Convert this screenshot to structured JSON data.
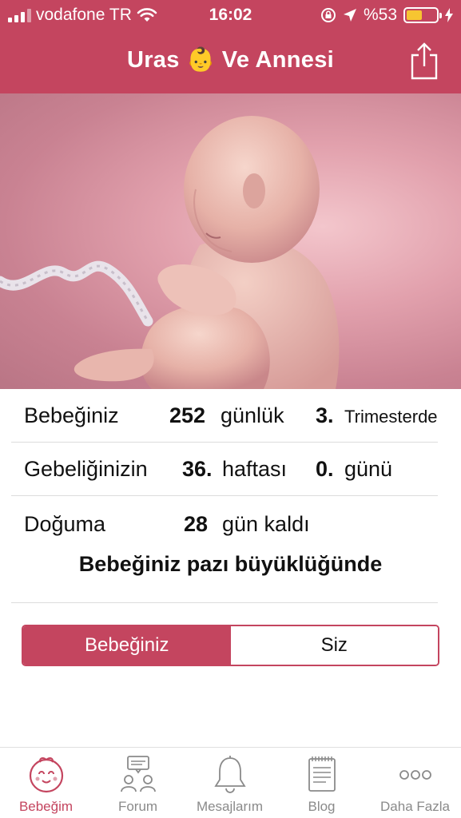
{
  "status_bar": {
    "carrier": "vodafone TR",
    "time": "16:02",
    "battery_text": "%53",
    "battery_level": 0.53
  },
  "nav": {
    "title": "Uras 👶 Ve Annesi",
    "share_icon": "share-icon"
  },
  "info": {
    "row1": {
      "label": "Bebeğiniz",
      "days_num": "252",
      "days_unit": "günlük",
      "trimester_num": "3.",
      "trimester_label": "Trimesterde"
    },
    "row2": {
      "label": "Gebeliğinizin",
      "week_num": "36.",
      "week_unit": "haftası",
      "day_num": "0.",
      "day_unit": "günü"
    },
    "row3": {
      "label": "Doğuma",
      "days_left_num": "28",
      "days_left_unit": "gün kaldı"
    },
    "size_text": "Bebeğiniz pazı büyüklüğünde"
  },
  "segment": {
    "options": [
      "Bebeğiniz",
      "Siz"
    ],
    "selected": "Bebeğiniz"
  },
  "tabbar": {
    "items": [
      {
        "label": "Bebeğim",
        "icon": "baby-face-icon",
        "active": true
      },
      {
        "label": "Forum",
        "icon": "forum-icon",
        "active": false
      },
      {
        "label": "Mesajlarım",
        "icon": "bell-icon",
        "active": false
      },
      {
        "label": "Blog",
        "icon": "notepad-icon",
        "active": false
      },
      {
        "label": "Daha Fazla",
        "icon": "more-dots-icon",
        "active": false
      }
    ]
  },
  "colors": {
    "accent": "#c4455f",
    "battery": "#f7c531",
    "tab_inactive": "#8a8a8a"
  }
}
